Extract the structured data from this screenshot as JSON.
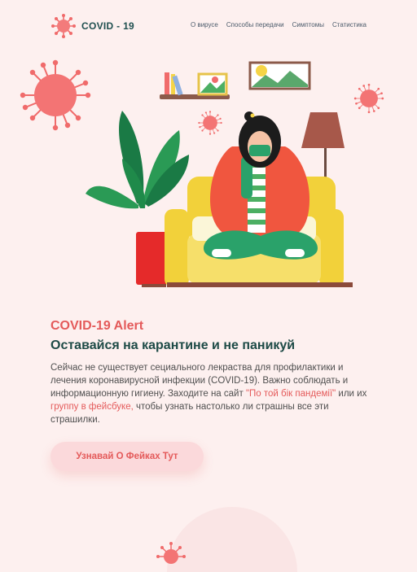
{
  "brand": {
    "name": "COVID - 19"
  },
  "nav": {
    "items": [
      "О вирусе",
      "Способы передачи",
      "Симптомы",
      "Статистика"
    ]
  },
  "hero": {
    "kicker": "COVID-19 Alert",
    "headline": "Оставайся на карантине и не паникуй",
    "desc_part1": "Сейчас не существует сециального лекраства для профилактики и лечения коронавирусной инфекции (COVID-19). Важно соблюдать и информационную гигиену. Заходите на сайт ",
    "link1": "\"По той бік пандемії\"",
    "desc_part2": " или их ",
    "link2": "группу в фейсбуке,",
    "desc_part3": " чтобы узнать настолько ли страшны все эти страшилки."
  },
  "cta": {
    "label": "Узнавай О Фейках Тут"
  },
  "colors": {
    "accent": "#e45a5a",
    "dark_green": "#1d4a46",
    "background": "#fdf0ef",
    "button_bg": "#fbd9db"
  }
}
